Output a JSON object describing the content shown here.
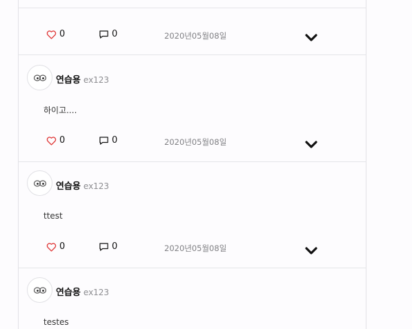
{
  "posts": [
    {
      "author": "",
      "handle": "",
      "content": "",
      "likes": "0",
      "comments": "0",
      "date": "2020년05월08일"
    },
    {
      "author": "연습용",
      "handle": "ex123",
      "content": "하이고....",
      "likes": "0",
      "comments": "0",
      "date": "2020년05월08일"
    },
    {
      "author": "연습용",
      "handle": "ex123",
      "content": "ttest",
      "likes": "0",
      "comments": "0",
      "date": "2020년05월08일"
    },
    {
      "author": "연습용",
      "handle": "ex123",
      "content": "testes",
      "likes": "",
      "comments": "",
      "date": ""
    }
  ],
  "colors": {
    "heart": "#e03a3a",
    "text": "#111111",
    "muted": "#808084",
    "border": "#e4e4e8"
  },
  "icons": [
    "heart-icon",
    "comment-icon",
    "chevron-down-icon",
    "avatar-image"
  ]
}
